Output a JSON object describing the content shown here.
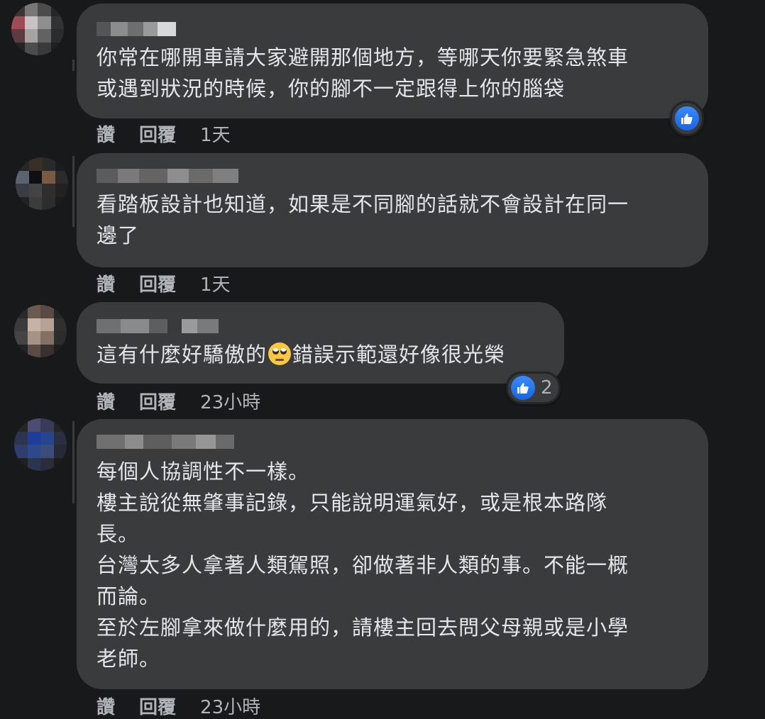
{
  "comments": [
    {
      "lines": [
        "你常在哪開車請大家避開那個地方，等哪天你要緊急煞車",
        "或遇到狀況的時候，你的腳不一定跟得上你的腦袋"
      ],
      "actions": {
        "like": "讚",
        "reply": "回覆",
        "time": "1天"
      },
      "reaction": {
        "icon": "thumbs-up-icon",
        "count": ""
      }
    },
    {
      "lines": [
        "看踏板設計也知道，如果是不同腳的話就不會設計在同一",
        "邊了"
      ],
      "actions": {
        "like": "讚",
        "reply": "回覆",
        "time": "1天"
      }
    },
    {
      "text_before_emoji": "這有什麼好驕傲的",
      "emoji": "face-with-rolling-eyes-emoji",
      "text_after_emoji": "錯誤示範還好像很光榮",
      "actions": {
        "like": "讚",
        "reply": "回覆",
        "time": "23小時"
      },
      "reaction": {
        "icon": "thumbs-up-icon",
        "count": "2"
      }
    },
    {
      "lines": [
        "每個人協調性不一樣。",
        "樓主說從無肇事記錄，只能說明運氣好，或是根本路隊",
        "長。",
        "台灣太多人拿著人類駕照，卻做著非人類的事。不能一概",
        "而論。",
        "至於左腳拿來做什麼用的，請樓主回去問父母親或是小學",
        "老師。"
      ],
      "actions": {
        "like": "讚",
        "reply": "回覆",
        "time": "23小時"
      }
    }
  ],
  "colors": {
    "background": "#18191a",
    "bubble": "#3a3b3c",
    "text": "#e4e6eb",
    "secondary_text": "#b0b3b8",
    "like_blue": "#1877f2"
  }
}
